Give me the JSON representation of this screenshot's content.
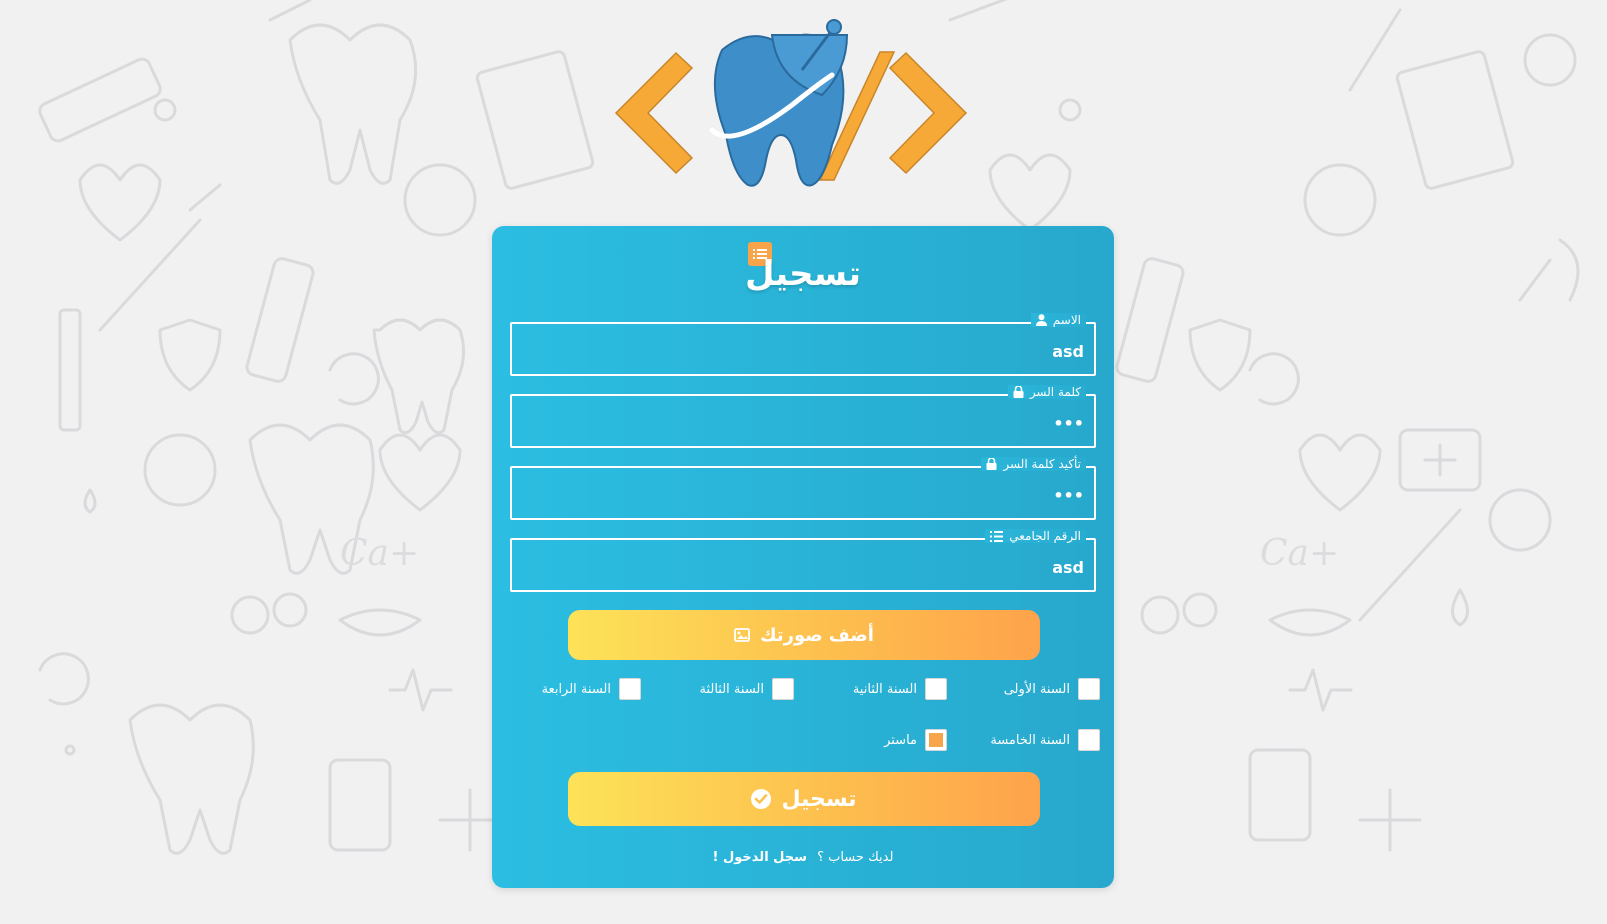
{
  "form": {
    "title": "تسجيل",
    "fields": [
      {
        "label": "الاسم",
        "icon": "user-icon",
        "value": "asd",
        "type": "text"
      },
      {
        "label": "كلمة السر",
        "icon": "lock-icon",
        "value": "•••",
        "type": "password"
      },
      {
        "label": "تأكيد كلمة السر",
        "icon": "lock-icon",
        "value": "•••",
        "type": "password"
      },
      {
        "label": "الرقم الجامعي",
        "icon": "list-icon",
        "value": "asd",
        "type": "text"
      }
    ],
    "add_photo_label": "أضف صورتك",
    "years": [
      {
        "label": "السنة الأولى",
        "checked": false
      },
      {
        "label": "السنة الثانية",
        "checked": false
      },
      {
        "label": "السنة الثالثة",
        "checked": false
      },
      {
        "label": "السنة الرابعة",
        "checked": false
      },
      {
        "label": "السنة الخامسة",
        "checked": false
      },
      {
        "label": "ماستر",
        "checked": true
      }
    ],
    "submit_label": "تسجيل",
    "footer": {
      "question": "لديك حساب ؟",
      "link": "سجل الدخول !"
    }
  },
  "colors": {
    "card_start": "#2bbee2",
    "card_end": "#27a8cc",
    "accent_orange": "#f7a44a",
    "button_yellow": "#fde258",
    "button_orange": "#fea34b",
    "logo_blue": "#3d8ec9",
    "background": "#f1f1f2"
  }
}
